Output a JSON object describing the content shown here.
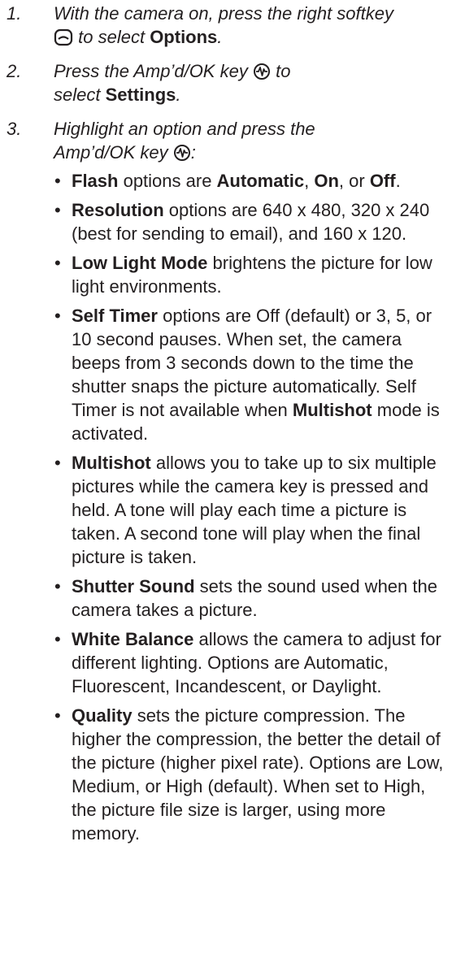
{
  "steps": [
    {
      "number": "1.",
      "parts": [
        "With the camera on, press the right softkey",
        "to select",
        "Options",
        "."
      ],
      "icon": "right-softkey-icon"
    },
    {
      "number": "2.",
      "parts": [
        "Press the Amp’d/OK key",
        "to",
        "select",
        "Settings",
        "."
      ],
      "icon": "ampd-ok-key-icon"
    },
    {
      "number": "3.",
      "parts": [
        "Highlight an option and press the",
        "Amp’d/OK key",
        ":"
      ],
      "icon": "ampd-ok-key-icon"
    }
  ],
  "options": [
    {
      "term": "Flash",
      "text": " options are ",
      "values": [
        "Automatic",
        "On",
        "Off"
      ],
      "sep1": ", ",
      "sep2": ", or ",
      "end": "."
    },
    {
      "term": "Resolution",
      "text": " options are 640 x 480, 320 x 240 (best for sending to email), and 160 x 120."
    },
    {
      "term": "Low Light Mode",
      "text": " brightens the picture for low light environments."
    },
    {
      "term": "Self Timer",
      "text": " options are Off (default) or 3, 5, or 10 second pauses. When set, the camera beeps from 3 seconds down to the time the shutter snaps the picture automatically. Self Timer is not available when ",
      "term2": "Multishot",
      "text2": " mode is activated."
    },
    {
      "term": "Multishot",
      "text": " allows you to take up to six multiple pictures while the camera key is pressed and held. A tone will play each time a picture is taken. A second tone will play when the final picture is taken."
    },
    {
      "term": "Shutter Sound",
      "text": " sets the sound used when the camera takes a picture."
    },
    {
      "term": "White Balance",
      "text": " allows the camera to adjust for different lighting. Options are Automatic, Fluorescent, Incandescent, or Daylight."
    },
    {
      "term": "Quality",
      "text": " sets the picture compression. The higher the compression, the better the detail of the picture (higher pixel rate). Options are Low, Medium, or High (default). When set to High, the picture file size is larger, using more memory."
    }
  ],
  "bullet": "•",
  "colors": {
    "text": "#231f20",
    "background": "#ffffff"
  }
}
